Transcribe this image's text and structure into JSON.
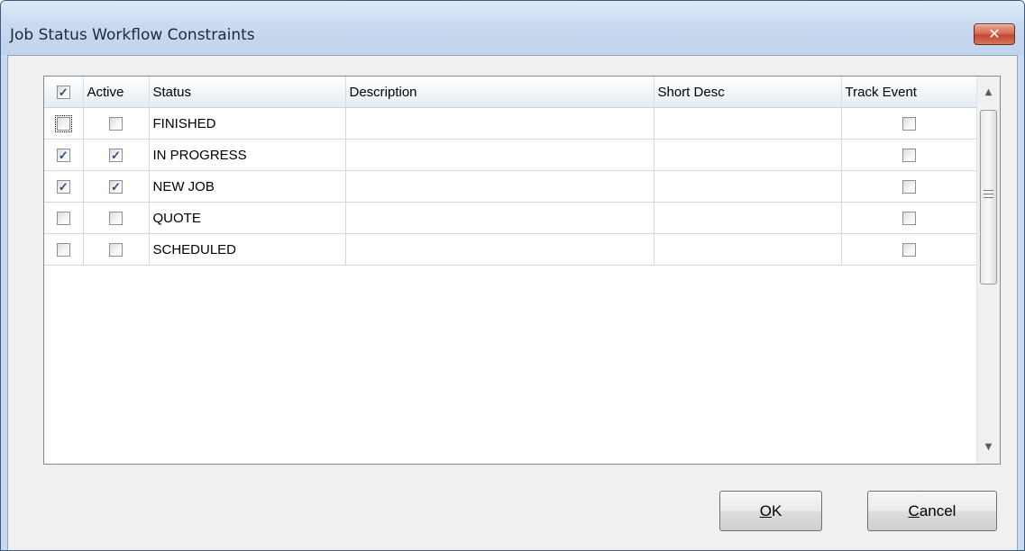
{
  "window": {
    "title": "Job Status Workflow Constraints",
    "close_label": "✕"
  },
  "grid": {
    "columns": {
      "select": "",
      "active": "Active",
      "status": "Status",
      "description": "Description",
      "short_desc": "Short Desc",
      "track_event": "Track Event"
    },
    "header_select_checked": true,
    "rows": [
      {
        "selected": false,
        "active": false,
        "status": "FINISHED",
        "description": "",
        "short_desc": "",
        "track_event": false
      },
      {
        "selected": true,
        "active": true,
        "status": "IN PROGRESS",
        "description": "",
        "short_desc": "",
        "track_event": false
      },
      {
        "selected": true,
        "active": true,
        "status": "NEW JOB",
        "description": "",
        "short_desc": "",
        "track_event": false
      },
      {
        "selected": false,
        "active": false,
        "status": "QUOTE",
        "description": "",
        "short_desc": "",
        "track_event": false
      },
      {
        "selected": false,
        "active": false,
        "status": "SCHEDULED",
        "description": "",
        "short_desc": "",
        "track_event": false
      }
    ]
  },
  "buttons": {
    "ok": {
      "mnemonic": "O",
      "rest": "K"
    },
    "cancel": {
      "mnemonic": "C",
      "rest": "ancel"
    }
  }
}
